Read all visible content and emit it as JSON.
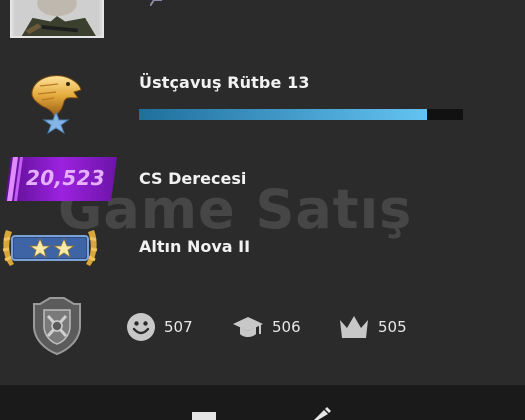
{
  "profile": {
    "avatar_icon": "soldier-avatar-icon",
    "rank": {
      "label": "Üstçavuş Rütbe 13",
      "icon": "eagle-rank-icon",
      "xp_fraction": 0.89,
      "xp_color": "#4fb3e8"
    },
    "cs_rating": {
      "value": "20,523",
      "label": "CS Derecesi",
      "badge_color": "#8e1fd0"
    },
    "skill_group": {
      "label": "Altın Nova II",
      "icon": "gold-nova-badge-icon"
    },
    "watermark": "Game Satış",
    "commendations": [
      {
        "icon": "smile-icon",
        "value": "507"
      },
      {
        "icon": "teacher-icon",
        "value": "506"
      },
      {
        "icon": "leader-crown-icon",
        "value": "505"
      }
    ]
  }
}
